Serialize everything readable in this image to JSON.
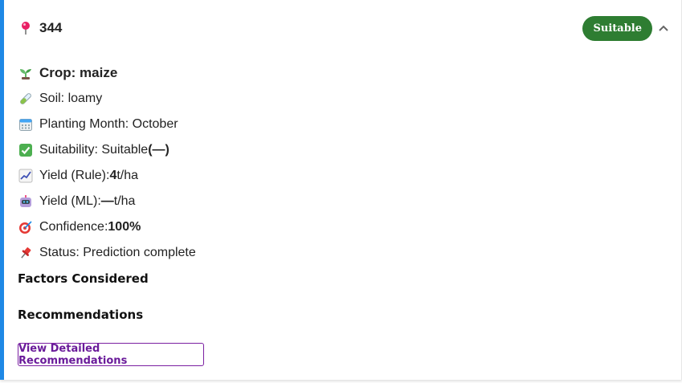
{
  "header": {
    "title": "344",
    "badge": "Suitable",
    "badge_color": "#2e7d32",
    "accent_color": "#1e88e5",
    "icons": {
      "pin": "map-pin-icon",
      "collapse": "chevron-up-icon"
    }
  },
  "details": {
    "crop_label": "Crop: maize",
    "soil_label": "Soil: loamy",
    "planting_label": "Planting Month: October",
    "suitability_prefix": "Suitability: Suitable ",
    "suitability_bold": "(—)",
    "yield_rule_prefix": "Yield (Rule): ",
    "yield_rule_value": "4",
    "yield_rule_unit": " t/ha",
    "yield_ml_prefix": "Yield (ML): ",
    "yield_ml_value": "—",
    "yield_ml_unit": " t/ha",
    "confidence_prefix": "Confidence: ",
    "confidence_value": "100%",
    "status_label": "Status: Prediction complete",
    "icons": [
      "seedling-icon",
      "test-tube-icon",
      "calendar-icon",
      "check-box-icon",
      "chart-icon",
      "robot-icon",
      "target-icon",
      "pushpin-icon"
    ]
  },
  "sections": {
    "factors": "Factors Considered",
    "recommendations": "Recommendations"
  },
  "actions": {
    "view_recommendations": "View Detailed Recommendations",
    "button_color": "#6a1b9a"
  }
}
